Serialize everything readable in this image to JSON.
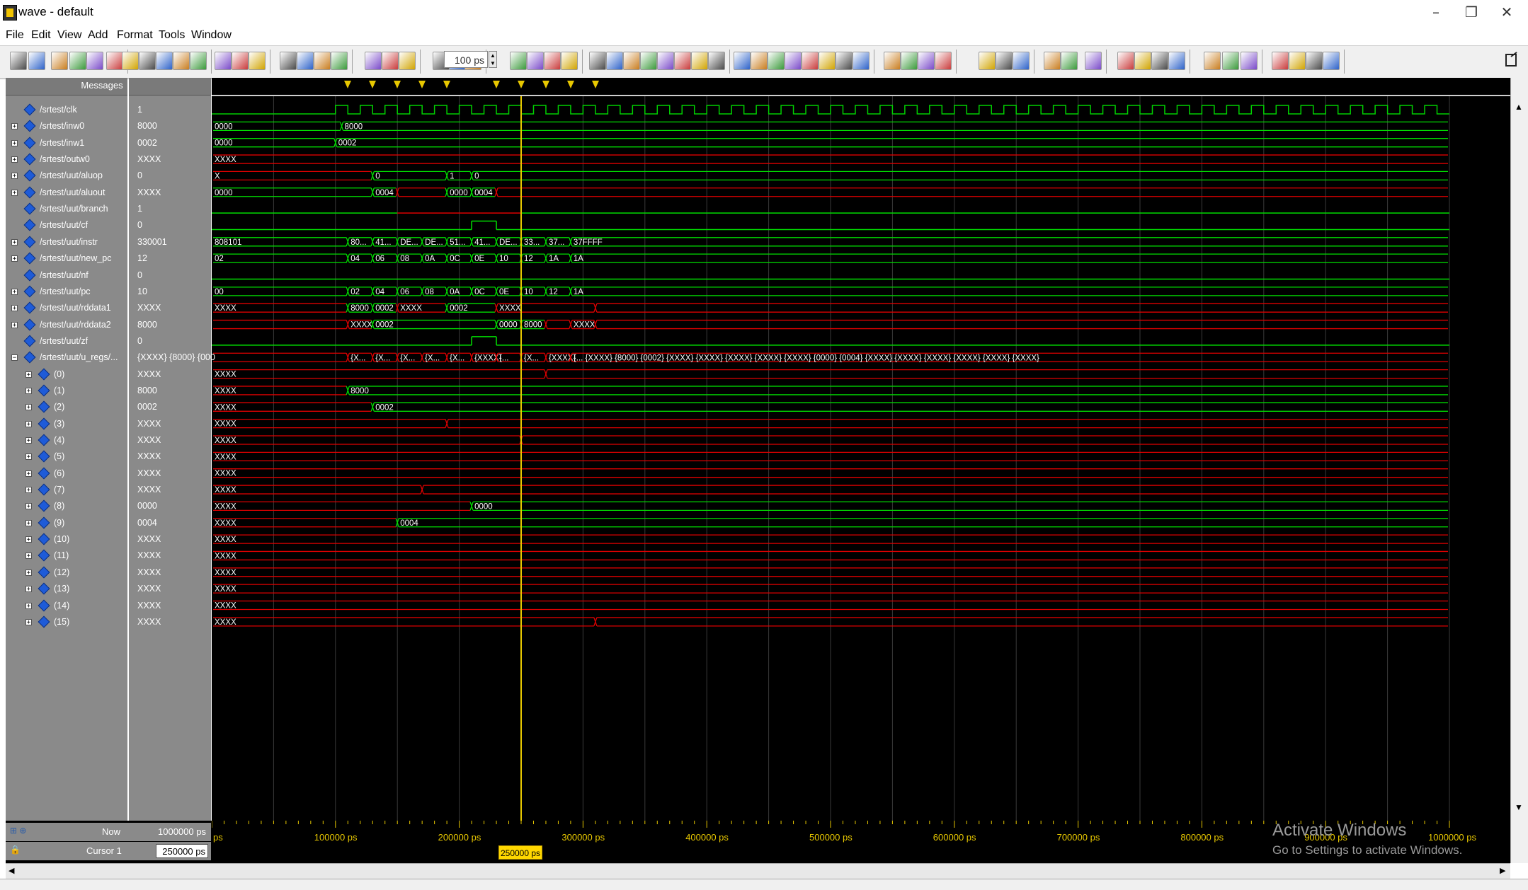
{
  "window": {
    "title": "wave - default",
    "minimize": "–",
    "restore": "❐",
    "close": "✕"
  },
  "menu": [
    "File",
    "Edit",
    "View",
    "Add",
    "Format",
    "Tools",
    "Window"
  ],
  "toolbar": {
    "zoom_value": "100 ps"
  },
  "panes": {
    "messages_header": "Messages"
  },
  "signals": [
    {
      "name": "/srtest/clk",
      "value": "1",
      "expandable": false
    },
    {
      "name": "/srtest/inw0",
      "value": "8000",
      "expandable": true
    },
    {
      "name": "/srtest/inw1",
      "value": "0002",
      "expandable": true
    },
    {
      "name": "/srtest/outw0",
      "value": "XXXX",
      "expandable": true
    },
    {
      "name": "/srtest/uut/aluop",
      "value": "0",
      "expandable": true
    },
    {
      "name": "/srtest/uut/aluout",
      "value": "XXXX",
      "expandable": true
    },
    {
      "name": "/srtest/uut/branch",
      "value": "1",
      "expandable": false
    },
    {
      "name": "/srtest/uut/cf",
      "value": "0",
      "expandable": false
    },
    {
      "name": "/srtest/uut/instr",
      "value": "330001",
      "expandable": true
    },
    {
      "name": "/srtest/uut/new_pc",
      "value": "12",
      "expandable": true
    },
    {
      "name": "/srtest/uut/nf",
      "value": "0",
      "expandable": false
    },
    {
      "name": "/srtest/uut/pc",
      "value": "10",
      "expandable": true
    },
    {
      "name": "/srtest/uut/rddata1",
      "value": "XXXX",
      "expandable": true
    },
    {
      "name": "/srtest/uut/rddata2",
      "value": "8000",
      "expandable": true
    },
    {
      "name": "/srtest/uut/zf",
      "value": "0",
      "expandable": false
    },
    {
      "name": "/srtest/uut/u_regs/...",
      "value": "{XXXX} {8000} {000",
      "expandable": true,
      "expanded": true
    },
    {
      "name": "(0)",
      "value": "XXXX",
      "expandable": true,
      "child": true
    },
    {
      "name": "(1)",
      "value": "8000",
      "expandable": true,
      "child": true
    },
    {
      "name": "(2)",
      "value": "0002",
      "expandable": true,
      "child": true
    },
    {
      "name": "(3)",
      "value": "XXXX",
      "expandable": true,
      "child": true
    },
    {
      "name": "(4)",
      "value": "XXXX",
      "expandable": true,
      "child": true
    },
    {
      "name": "(5)",
      "value": "XXXX",
      "expandable": true,
      "child": true
    },
    {
      "name": "(6)",
      "value": "XXXX",
      "expandable": true,
      "child": true
    },
    {
      "name": "(7)",
      "value": "XXXX",
      "expandable": true,
      "child": true
    },
    {
      "name": "(8)",
      "value": "0000",
      "expandable": true,
      "child": true
    },
    {
      "name": "(9)",
      "value": "0004",
      "expandable": true,
      "child": true
    },
    {
      "name": "(10)",
      "value": "XXXX",
      "expandable": true,
      "child": true
    },
    {
      "name": "(11)",
      "value": "XXXX",
      "expandable": true,
      "child": true
    },
    {
      "name": "(12)",
      "value": "XXXX",
      "expandable": true,
      "child": true
    },
    {
      "name": "(13)",
      "value": "XXXX",
      "expandable": true,
      "child": true
    },
    {
      "name": "(14)",
      "value": "XXXX",
      "expandable": true,
      "child": true
    },
    {
      "name": "(15)",
      "value": "XXXX",
      "expandable": true,
      "child": true
    }
  ],
  "waves": [
    {
      "kind": "clock"
    },
    {
      "kind": "bus",
      "segs": [
        [
          0,
          105,
          "0000",
          "g"
        ],
        [
          105,
          1000,
          "8000",
          "g"
        ]
      ]
    },
    {
      "kind": "bus",
      "segs": [
        [
          0,
          100,
          "0000",
          "g"
        ],
        [
          100,
          1000,
          "0002",
          "g"
        ]
      ]
    },
    {
      "kind": "bus",
      "segs": [
        [
          0,
          1000,
          "XXXX",
          "r"
        ]
      ]
    },
    {
      "kind": "bus",
      "segs": [
        [
          0,
          130,
          "X",
          "r"
        ],
        [
          130,
          190,
          "0",
          "g"
        ],
        [
          190,
          210,
          "1",
          "g"
        ],
        [
          210,
          1000,
          "0",
          "g"
        ]
      ]
    },
    {
      "kind": "bus",
      "segs": [
        [
          0,
          130,
          "0000",
          "g"
        ],
        [
          130,
          150,
          "0004",
          "g"
        ],
        [
          150,
          190,
          "",
          "r"
        ],
        [
          190,
          210,
          "0000",
          "g"
        ],
        [
          210,
          230,
          "0004",
          "g"
        ],
        [
          230,
          1000,
          "",
          "r"
        ]
      ]
    },
    {
      "kind": "bit",
      "segs": [
        [
          0,
          150,
          0,
          "g"
        ],
        [
          150,
          250,
          0,
          "r"
        ],
        [
          250,
          1000,
          0,
          "g"
        ]
      ]
    },
    {
      "kind": "bit",
      "segs": [
        [
          0,
          210,
          0,
          "g"
        ],
        [
          210,
          230,
          1,
          "g"
        ],
        [
          230,
          1000,
          0,
          "g"
        ]
      ]
    },
    {
      "kind": "bus",
      "segs": [
        [
          0,
          110,
          "808101",
          "g"
        ],
        [
          110,
          130,
          "80...",
          "g"
        ],
        [
          130,
          150,
          "41...",
          "g"
        ],
        [
          150,
          170,
          "DE...",
          "g"
        ],
        [
          170,
          190,
          "DE...",
          "g"
        ],
        [
          190,
          210,
          "51...",
          "g"
        ],
        [
          210,
          230,
          "41...",
          "g"
        ],
        [
          230,
          250,
          "DE...",
          "g"
        ],
        [
          250,
          270,
          "33...",
          "g"
        ],
        [
          270,
          290,
          "37...",
          "g"
        ],
        [
          290,
          1000,
          "37FFFF",
          "g"
        ]
      ]
    },
    {
      "kind": "bus",
      "segs": [
        [
          0,
          110,
          "02",
          "g"
        ],
        [
          110,
          130,
          "04",
          "g"
        ],
        [
          130,
          150,
          "06",
          "g"
        ],
        [
          150,
          170,
          "08",
          "g"
        ],
        [
          170,
          190,
          "0A",
          "g"
        ],
        [
          190,
          210,
          "0C",
          "g"
        ],
        [
          210,
          230,
          "0E",
          "g"
        ],
        [
          230,
          250,
          "10",
          "g"
        ],
        [
          250,
          270,
          "12",
          "g"
        ],
        [
          270,
          290,
          "1A",
          "g"
        ],
        [
          290,
          1000,
          "1A",
          "g"
        ]
      ]
    },
    {
      "kind": "bit",
      "segs": [
        [
          0,
          1000,
          0,
          "g"
        ]
      ]
    },
    {
      "kind": "bus",
      "segs": [
        [
          0,
          110,
          "00",
          "g"
        ],
        [
          110,
          130,
          "02",
          "g"
        ],
        [
          130,
          150,
          "04",
          "g"
        ],
        [
          150,
          170,
          "06",
          "g"
        ],
        [
          170,
          190,
          "08",
          "g"
        ],
        [
          190,
          210,
          "0A",
          "g"
        ],
        [
          210,
          230,
          "0C",
          "g"
        ],
        [
          230,
          250,
          "0E",
          "g"
        ],
        [
          250,
          270,
          "10",
          "g"
        ],
        [
          270,
          290,
          "12",
          "g"
        ],
        [
          290,
          1000,
          "1A",
          "g"
        ]
      ]
    },
    {
      "kind": "bus",
      "segs": [
        [
          0,
          110,
          "XXXX",
          "r"
        ],
        [
          110,
          130,
          "8000",
          "g"
        ],
        [
          130,
          150,
          "0002",
          "g"
        ],
        [
          150,
          190,
          "XXXX",
          "r"
        ],
        [
          190,
          230,
          "0002",
          "g"
        ],
        [
          230,
          310,
          "XXXX",
          "r"
        ],
        [
          310,
          1000,
          "",
          "r"
        ]
      ]
    },
    {
      "kind": "bus",
      "segs": [
        [
          0,
          110,
          "",
          "r"
        ],
        [
          110,
          130,
          "XXXX",
          "r"
        ],
        [
          130,
          230,
          "0002",
          "g"
        ],
        [
          230,
          250,
          "0000",
          "g"
        ],
        [
          250,
          270,
          "8000",
          "g"
        ],
        [
          270,
          290,
          "",
          "r"
        ],
        [
          290,
          310,
          "XXXX",
          "r"
        ],
        [
          310,
          1000,
          "",
          "r"
        ]
      ]
    },
    {
      "kind": "bit",
      "segs": [
        [
          0,
          210,
          0,
          "g"
        ],
        [
          210,
          230,
          1,
          "g"
        ],
        [
          230,
          1000,
          0,
          "g"
        ]
      ]
    },
    {
      "kind": "bus",
      "segs": [
        [
          0,
          110,
          "",
          "r"
        ],
        [
          110,
          130,
          "{X...",
          "r"
        ],
        [
          130,
          150,
          "{X...",
          "r"
        ],
        [
          150,
          170,
          "{X...",
          "r"
        ],
        [
          170,
          190,
          "{X...",
          "r"
        ],
        [
          190,
          210,
          "{X...",
          "r"
        ],
        [
          210,
          230,
          "{XXXX}",
          "r"
        ],
        [
          230,
          250,
          "{...",
          "r"
        ],
        [
          250,
          270,
          "{X...",
          "r"
        ],
        [
          270,
          290,
          "{XXXX}",
          "r"
        ],
        [
          290,
          1000,
          "{...  {XXXX} {8000} {0002} {XXXX} {XXXX} {XXXX} {XXXX} {XXXX} {0000} {0004} {XXXX} {XXXX} {XXXX} {XXXX} {XXXX} {XXXX}",
          "r"
        ]
      ]
    },
    {
      "kind": "bus",
      "segs": [
        [
          0,
          270,
          "XXXX",
          "r"
        ],
        [
          270,
          1000,
          "",
          "r"
        ]
      ]
    },
    {
      "kind": "bus",
      "segs": [
        [
          0,
          110,
          "XXXX",
          "r"
        ],
        [
          110,
          1000,
          "8000",
          "g"
        ]
      ]
    },
    {
      "kind": "bus",
      "segs": [
        [
          0,
          130,
          "XXXX",
          "r"
        ],
        [
          130,
          1000,
          "0002",
          "g"
        ]
      ]
    },
    {
      "kind": "bus",
      "segs": [
        [
          0,
          190,
          "XXXX",
          "r"
        ],
        [
          190,
          1000,
          "",
          "r"
        ]
      ]
    },
    {
      "kind": "bus",
      "segs": [
        [
          0,
          250,
          "XXXX",
          "r"
        ],
        [
          250,
          1000,
          "",
          "r"
        ]
      ]
    },
    {
      "kind": "bus",
      "segs": [
        [
          0,
          1000,
          "XXXX",
          "r"
        ]
      ]
    },
    {
      "kind": "bus",
      "segs": [
        [
          0,
          1000,
          "XXXX",
          "r"
        ]
      ]
    },
    {
      "kind": "bus",
      "segs": [
        [
          0,
          170,
          "XXXX",
          "r"
        ],
        [
          170,
          1000,
          "",
          "r"
        ]
      ]
    },
    {
      "kind": "bus",
      "segs": [
        [
          0,
          210,
          "XXXX",
          "r"
        ],
        [
          210,
          1000,
          "0000",
          "g"
        ]
      ]
    },
    {
      "kind": "bus",
      "segs": [
        [
          0,
          150,
          "XXXX",
          "r"
        ],
        [
          150,
          1000,
          "0004",
          "g"
        ]
      ]
    },
    {
      "kind": "bus",
      "segs": [
        [
          0,
          1000,
          "XXXX",
          "r"
        ]
      ]
    },
    {
      "kind": "bus",
      "segs": [
        [
          0,
          1000,
          "XXXX",
          "r"
        ]
      ]
    },
    {
      "kind": "bus",
      "segs": [
        [
          0,
          1000,
          "XXXX",
          "r"
        ]
      ]
    },
    {
      "kind": "bus",
      "segs": [
        [
          0,
          1000,
          "XXXX",
          "r"
        ]
      ]
    },
    {
      "kind": "bus",
      "segs": [
        [
          0,
          1000,
          "XXXX",
          "r"
        ]
      ]
    },
    {
      "kind": "bus",
      "segs": [
        [
          0,
          310,
          "XXXX",
          "r"
        ],
        [
          310,
          1000,
          "",
          "r"
        ]
      ]
    }
  ],
  "timeline": {
    "range_ps": [
      0,
      1000000
    ],
    "cursor_ps": 250000,
    "marker_times_ps": [
      110000,
      130000,
      150000,
      170000,
      190000,
      230000,
      250000,
      270000,
      290000,
      310000
    ],
    "tick_labels": [
      "ps",
      "100000 ps",
      "200000 ps",
      "300000 ps",
      "400000 ps",
      "500000 ps",
      "600000 ps",
      "700000 ps",
      "800000 ps",
      "900000 ps",
      "1000000 ps"
    ]
  },
  "footer": {
    "now_label": "Now",
    "now_value": "1000000 ps",
    "cursor_label": "Cursor 1",
    "cursor_value": "250000 ps",
    "cursor_tag": "250000 ps"
  },
  "watermark": {
    "line1": "Activate Windows",
    "line2": "Go to Settings to activate Windows."
  },
  "colors": {
    "green": "#00e000",
    "red": "#e00000",
    "clock": "#00d000",
    "cursor": "#e8c800"
  }
}
